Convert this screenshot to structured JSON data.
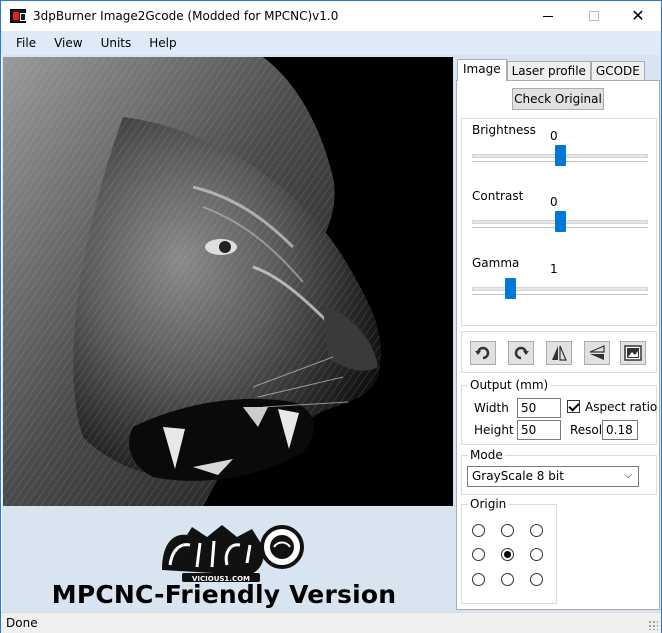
{
  "window": {
    "title": "3dpBurner Image2Gcode (Modded for MPCNC)v1.0",
    "minimize_icon": "minimize-icon",
    "maximize_icon": "maximize-icon",
    "close_glyph": "✕"
  },
  "menu": {
    "items": [
      "File",
      "View",
      "Units",
      "Help"
    ]
  },
  "left": {
    "logo_text": "VICIOUS1.COM",
    "version_text": "MPCNC-Friendly Version"
  },
  "right": {
    "tabs": [
      "Image",
      "Laser profile",
      "GCODE"
    ],
    "active_tab": "Image",
    "check_original_label": "Check Original",
    "brightness": {
      "label": "Brightness",
      "value": "0",
      "fraction": 0.5
    },
    "contrast": {
      "label": "Contrast",
      "value": "0",
      "fraction": 0.5
    },
    "gamma": {
      "label": "Gamma",
      "value": "1",
      "fraction": 0.2
    },
    "tools": [
      "rotate-left-icon",
      "rotate-right-icon",
      "flip-horizontal-icon",
      "flip-vertical-icon",
      "invert-image-icon"
    ],
    "output": {
      "legend": "Output (mm)",
      "width_label": "Width",
      "width_value": "50",
      "height_label": "Height",
      "height_value": "50",
      "aspect_label": "Aspect ratio",
      "aspect_checked": true,
      "resol_label": "Resol",
      "resol_value": "0.18"
    },
    "mode": {
      "legend": "Mode",
      "selected": "GrayScale 8 bit"
    },
    "origin": {
      "legend": "Origin",
      "selected_index": 4
    }
  },
  "status": {
    "text": "Done"
  },
  "colors": {
    "accent": "#0078d7",
    "menu_bg": "#dfeaf7",
    "panel_bg": "#d9e4f1"
  }
}
